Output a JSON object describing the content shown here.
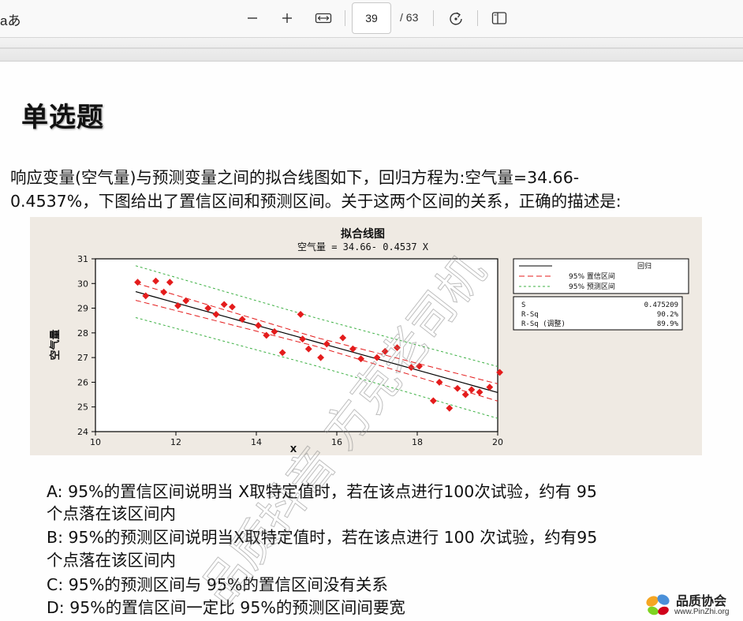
{
  "toolbar": {
    "read_aloud_label": "aあ",
    "zoom_out_icon": "minus-icon",
    "zoom_in_icon": "plus-icon",
    "fit_width_icon": "fit-width-icon",
    "page_number": "39",
    "page_total": "/ 63",
    "rotate_icon": "rotate-icon",
    "page_view_icon": "page-view-icon"
  },
  "document": {
    "heading": "单选题",
    "question_lines": [
      "响应变量(空气量)与预测变量之间的拟合线图如下，回归方程为:空气量=34.66-",
      "0.4537%，下图给出了置信区间和预测区间。关于这两个区间的关系，正确的描述是:"
    ],
    "options": [
      "A:  95%的置信区间说明当 X取特定值时，若在该点进行100次试验，约有 95",
      "个点落在该区间内",
      "B:  95%的预测区间说明当X取特定值时，若在该点进行 100 次试验，约有95",
      "个点落在该区间内",
      "C:  95%的预测区间与 95%的置信区间没有关系",
      "D:  95%的置信区间一定比 95%的预测区间间要宽"
    ]
  },
  "figure": {
    "title": "拟合线图",
    "subtitle": "空气量  =  34.66- 0.4537 X",
    "ylabel": "空气量",
    "xlabel": "X",
    "legend": [
      {
        "style": "solid",
        "label": "回归"
      },
      {
        "style": "dashed-red",
        "label": "95%  置信区间"
      },
      {
        "style": "dashed-green",
        "label": "95%  预测区间"
      }
    ],
    "stats": [
      {
        "label": "S",
        "value": "0.475209"
      },
      {
        "label": "R-Sq",
        "value": "90.2%"
      },
      {
        "label": "R-Sq (调整)",
        "value": "89.9%"
      }
    ],
    "colors": {
      "points": "#e41c1c",
      "regression": "#000000",
      "ci": "#e41c1c",
      "pi": "#3cb043"
    }
  },
  "chart_data": {
    "type": "scatter",
    "title": "拟合线图",
    "subtitle": "空气量  =  34.66- 0.4537 X",
    "xlabel": "X",
    "ylabel": "空气量",
    "xlim": [
      10,
      20
    ],
    "ylim": [
      24,
      31
    ],
    "xticks": [
      10,
      12,
      14,
      16,
      18,
      20
    ],
    "yticks": [
      24,
      25,
      26,
      27,
      28,
      29,
      30,
      31
    ],
    "regression": {
      "intercept": 34.66,
      "slope": -0.4537
    },
    "ci_halfwidth": [
      0.35,
      0.18,
      0.35
    ],
    "pi_halfwidth": [
      1.05,
      0.97,
      1.05
    ],
    "points": [
      {
        "x": 11.05,
        "y": 30.05
      },
      {
        "x": 11.25,
        "y": 29.5
      },
      {
        "x": 11.5,
        "y": 30.1
      },
      {
        "x": 11.7,
        "y": 29.65
      },
      {
        "x": 11.85,
        "y": 30.05
      },
      {
        "x": 12.05,
        "y": 29.1
      },
      {
        "x": 12.25,
        "y": 29.3
      },
      {
        "x": 12.8,
        "y": 29.0
      },
      {
        "x": 13.0,
        "y": 28.75
      },
      {
        "x": 13.2,
        "y": 29.15
      },
      {
        "x": 13.4,
        "y": 29.05
      },
      {
        "x": 13.65,
        "y": 28.55
      },
      {
        "x": 14.05,
        "y": 28.3
      },
      {
        "x": 14.25,
        "y": 27.9
      },
      {
        "x": 14.45,
        "y": 28.05
      },
      {
        "x": 14.65,
        "y": 27.2
      },
      {
        "x": 15.1,
        "y": 28.75
      },
      {
        "x": 15.15,
        "y": 27.75
      },
      {
        "x": 15.3,
        "y": 27.35
      },
      {
        "x": 15.6,
        "y": 27.0
      },
      {
        "x": 15.75,
        "y": 27.55
      },
      {
        "x": 16.15,
        "y": 27.8
      },
      {
        "x": 16.4,
        "y": 27.35
      },
      {
        "x": 16.6,
        "y": 26.95
      },
      {
        "x": 17.0,
        "y": 27.0
      },
      {
        "x": 17.2,
        "y": 27.25
      },
      {
        "x": 17.5,
        "y": 27.4
      },
      {
        "x": 17.85,
        "y": 26.6
      },
      {
        "x": 18.05,
        "y": 26.65
      },
      {
        "x": 18.4,
        "y": 25.25
      },
      {
        "x": 18.55,
        "y": 26.0
      },
      {
        "x": 18.8,
        "y": 24.95
      },
      {
        "x": 19.0,
        "y": 25.75
      },
      {
        "x": 19.2,
        "y": 25.5
      },
      {
        "x": 19.35,
        "y": 25.7
      },
      {
        "x": 19.55,
        "y": 25.6
      },
      {
        "x": 19.8,
        "y": 25.8
      },
      {
        "x": 20.05,
        "y": 26.4
      }
    ]
  },
  "watermark": {
    "text": "品质抖音 方克老司机"
  },
  "logo": {
    "name": "品质协会",
    "url": "www.PinZhi.org"
  }
}
